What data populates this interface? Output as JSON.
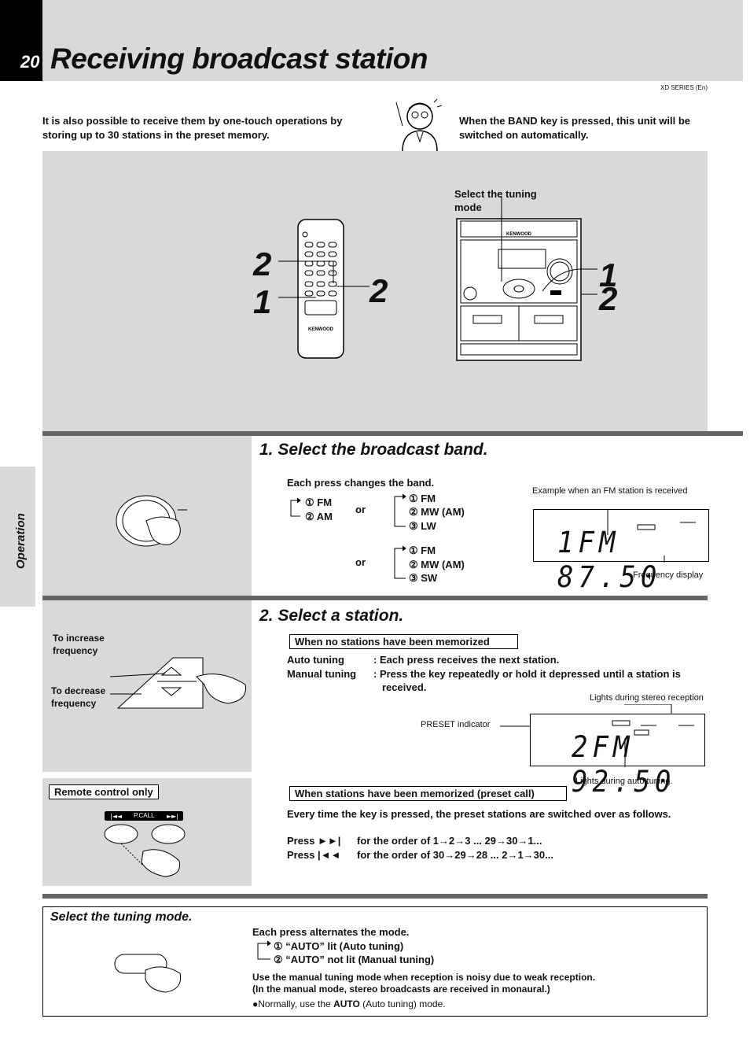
{
  "header": {
    "page_number": "20",
    "title": "Receiving broadcast station",
    "series": "XD SERIES (En)"
  },
  "intro": {
    "left": "It is also possible to receive them by one-touch operations by storing up to 30 stations in the preset memory.",
    "right": "When the BAND key is pressed, this unit will be switched on automatically."
  },
  "diagram": {
    "tuning_mode_label": "Select the tuning mode",
    "remote_brand": "KENWOOD",
    "unit_brand": "KENWOOD",
    "remote_callouts": [
      "2",
      "1",
      "2"
    ],
    "unit_callouts": [
      "1",
      "2"
    ]
  },
  "side_tab": "Operation",
  "step1": {
    "title": "1. Select the broadcast band.",
    "each_press": "Each press changes the band.",
    "seq_a": [
      "① FM",
      "② AM"
    ],
    "or1": "or",
    "seq_b": [
      "① FM",
      "② MW (AM)",
      "③ LW"
    ],
    "or2": "or",
    "seq_c": [
      "① FM",
      "② MW (AM)",
      "③ SW"
    ],
    "example_label": "Example when an FM station is received",
    "display_text": "1FM  87.50",
    "freq_display_label": "Frequency display"
  },
  "step2": {
    "title": "2. Select a station.",
    "inc_label": "To increase frequency",
    "dec_label": "To decrease frequency",
    "no_memo_label": "When no stations have been memorized",
    "auto_tuning": "Auto tuning",
    "auto_desc": ": Each press receives the next station.",
    "manual_tuning": "Manual tuning",
    "manual_desc": ": Press the key repeatedly or hold it depressed until a station is received.",
    "stereo_label": "Lights during stereo reception",
    "preset_indicator": "PRESET indicator",
    "display_text": "2FM  92.50",
    "auto_label": "Lights during auto tuning.",
    "remote_only": "Remote control only",
    "pcall_label": "P.CALL",
    "memo_label": "When stations have been memorized (preset call)",
    "every_time": "Every time the key is pressed, the preset stations are switched over as follows.",
    "press1": "Press ►►|",
    "press1_desc": "for the order of 1→2→3 ... 29→30→1...",
    "press2": "Press |◄◄",
    "press2_desc": "for the order of 30→29→28 ... 2→1→30..."
  },
  "tuning_mode": {
    "title": "Select the tuning mode.",
    "each_press": "Each press alternates the mode.",
    "opt1": "① “AUTO” lit (Auto tuning)",
    "opt2": "② “AUTO” not lit (Manual tuning)",
    "note1": "Use the manual tuning mode when reception is noisy due to weak reception.",
    "note2": "(In the manual mode, stereo broadcasts are received in monaural.)",
    "normally_pre": "Normally, use the ",
    "normally_bold": "AUTO",
    "normally_post": " (Auto tuning) mode."
  }
}
